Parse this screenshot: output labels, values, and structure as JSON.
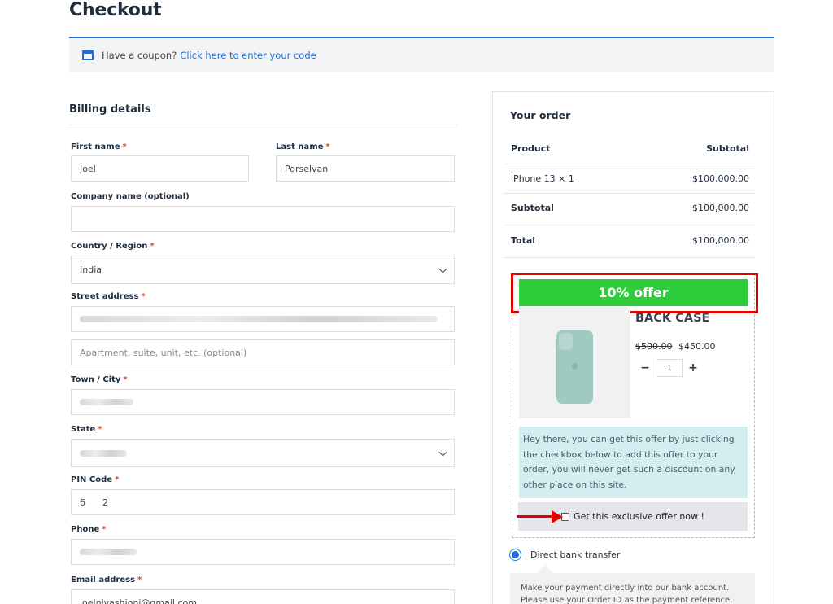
{
  "page_title": "Checkout",
  "coupon": {
    "text": "Have a coupon?",
    "link": "Click here to enter your code"
  },
  "billing": {
    "title": "Billing details",
    "required_mark": "*",
    "first_name_label": "First name",
    "first_name_value": "Joel",
    "last_name_label": "Last name",
    "last_name_value": "Porselvan",
    "company_label": "Company name (optional)",
    "company_value": "",
    "country_label": "Country / Region",
    "country_value": "India",
    "street_label": "Street address",
    "street_value": "",
    "apartment_placeholder": "Apartment, suite, unit, etc. (optional)",
    "city_label": "Town / City",
    "city_value": "",
    "state_label": "State",
    "state_value": "",
    "pin_label": "PIN Code",
    "pin_value": "6      2",
    "phone_label": "Phone",
    "phone_value": "",
    "email_label": "Email address",
    "email_value": "joelnivashioni@gmail.com"
  },
  "order": {
    "title": "Your order",
    "col_product": "Product",
    "col_subtotal": "Subtotal",
    "item_name": "iPhone 13 × 1",
    "item_price": "$100,000.00",
    "subtotal_label": "Subtotal",
    "subtotal_value": "$100,000.00",
    "total_label": "Total",
    "total_value": "$100,000.00"
  },
  "offer": {
    "banner": "10% offer",
    "product_name": "BACK CASE",
    "old_price": "$500.00",
    "new_price": "$450.00",
    "qty_minus": "−",
    "qty": "1",
    "qty_plus": "+",
    "description": "Hey there, you can get this offer by just clicking the checkbox below to add this offer to your order, you will never get such a discount on any other place on this site.",
    "checkbox_label": "Get this exclusive offer now !"
  },
  "payment": {
    "method": "Direct bank transfer",
    "description": "Make your payment directly into our bank account. Please use your Order ID as the payment reference. Your order"
  },
  "colors": {
    "accent": "#1e6fd9",
    "offer_green": "#2fcc3b",
    "highlight_red": "#e00000",
    "required": "#e2401c"
  }
}
